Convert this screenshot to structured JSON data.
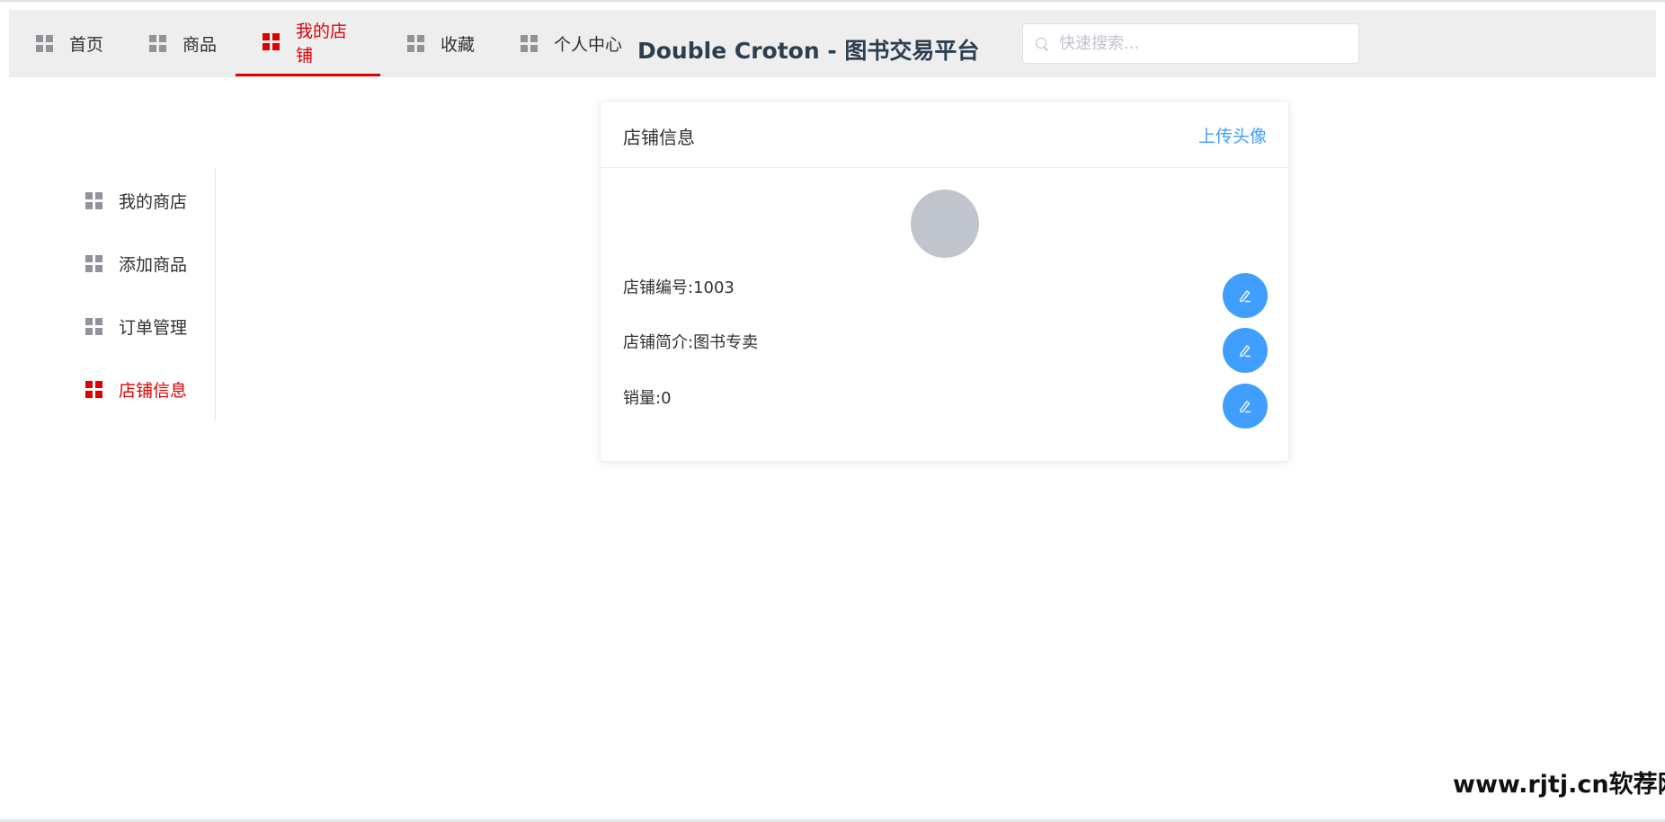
{
  "nav": {
    "items": [
      {
        "label": "首页",
        "active": false
      },
      {
        "label": "商品",
        "active": false
      },
      {
        "label": "我的店铺",
        "active": true
      },
      {
        "label": "收藏",
        "active": false
      },
      {
        "label": "个人中心",
        "active": false
      }
    ],
    "site_title": "Double Croton - 图书交易平台",
    "search_placeholder": "快速搜索..."
  },
  "side_menu": {
    "items": [
      {
        "label": "我的商店",
        "active": false
      },
      {
        "label": "添加商品",
        "active": false
      },
      {
        "label": "订单管理",
        "active": false
      },
      {
        "label": "店铺信息",
        "active": true
      }
    ]
  },
  "shop_card": {
    "title": "店铺信息",
    "upload_label": "上传头像",
    "shop_id": "店铺编号:1003",
    "intro": "店铺简介:图书专卖",
    "sales": "销量:0"
  },
  "watermark": "www.rjtj.cn软荐网",
  "colors": {
    "accent_red": "#e00000",
    "primary_blue": "#409eff",
    "avatar_gray": "#c0c4cc"
  }
}
